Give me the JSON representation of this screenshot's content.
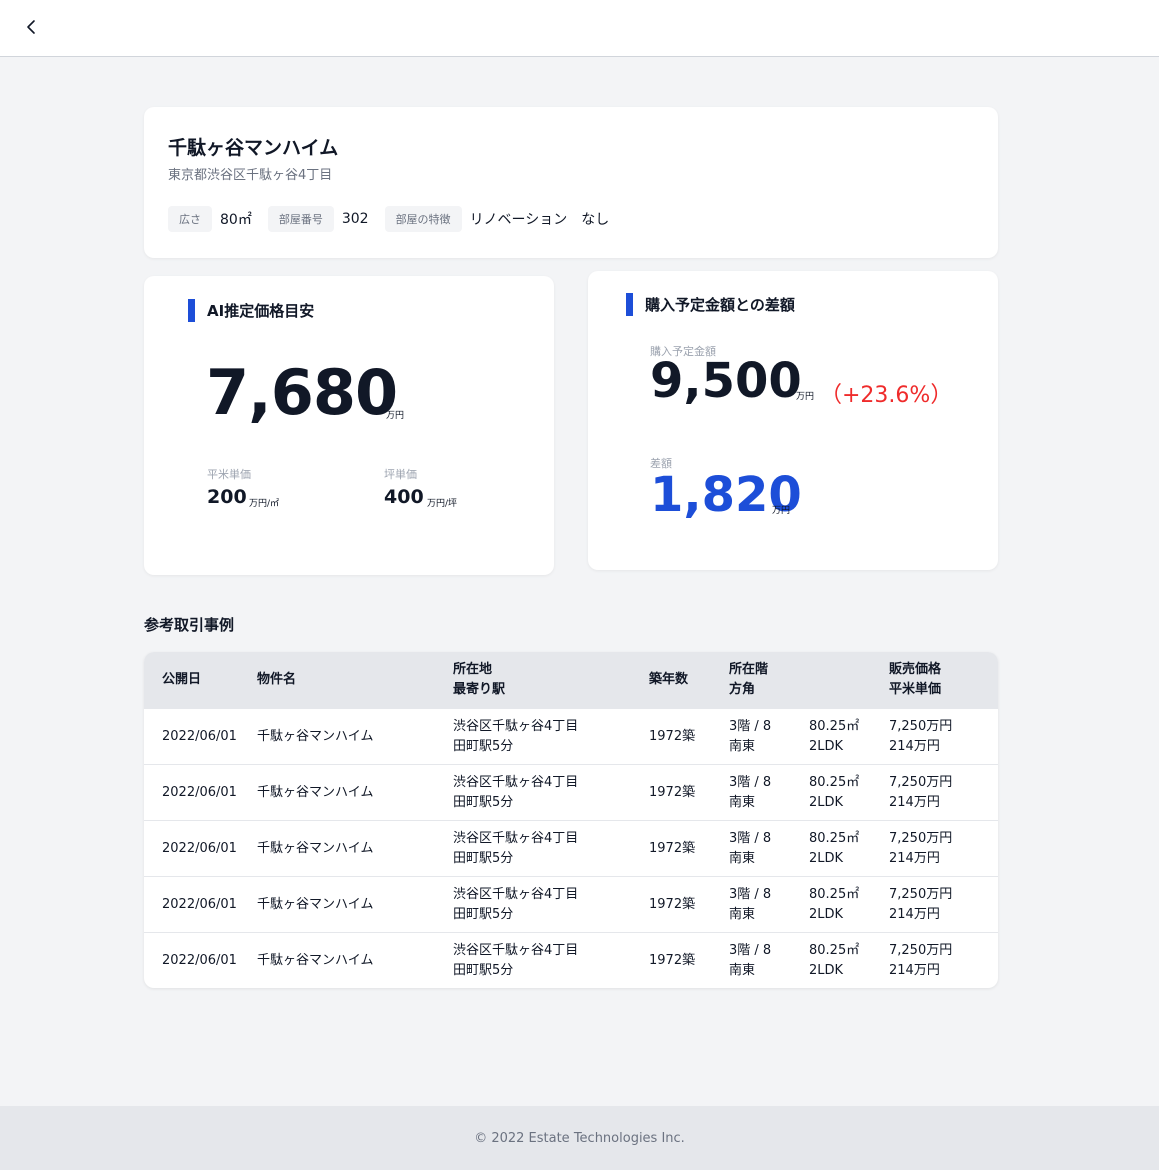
{
  "header": {
    "back_icon": "chevron-left-icon"
  },
  "property": {
    "name": "千駄ヶ谷マンハイム",
    "address": "東京都渋谷区千駄ヶ谷4丁目",
    "area_label": "広さ",
    "area_value": "80㎡",
    "room_label": "部屋番号",
    "room_value": "302",
    "feature_label": "部屋の特徴",
    "feature_value": "リノベーション",
    "feature_extra": "なし"
  },
  "ai_estimate": {
    "title": "AI推定価格目安",
    "price": "7,680",
    "price_unit": "万円",
    "sqm_label": "平米単価",
    "sqm_value": "200",
    "sqm_unit": "万円/㎡",
    "tsubo_label": "坪単価",
    "tsubo_value": "400",
    "tsubo_unit": "万円/坪"
  },
  "difference": {
    "title": "購入予定金額との差額",
    "planned_label": "購入予定金額",
    "planned_value": "9,500",
    "planned_unit": "万円",
    "planned_pct": "（+23.6%）",
    "gap_label": "差額",
    "gap_value": "1,820",
    "gap_unit": "万円"
  },
  "reference": {
    "title": "参考取引事例",
    "columns": {
      "date": "公開日",
      "name": "物件名",
      "location_1": "所在地",
      "location_2": "最寄り駅",
      "year": "築年数",
      "floor_1": "所在階",
      "floor_2": "方角",
      "price_1": "販売価格",
      "price_2": "平米単価"
    },
    "rows": [
      {
        "date": "2022/06/01",
        "name": "千駄ヶ谷マンハイム",
        "address": "渋谷区千駄ヶ谷4丁目",
        "station": "田町駅5分",
        "year": "1972築",
        "floor": "3階 / 8",
        "direction": "南東",
        "area": "80.25㎡",
        "layout": "2LDK",
        "price": "7,250万円",
        "unit_price": "214万円"
      },
      {
        "date": "2022/06/01",
        "name": "千駄ヶ谷マンハイム",
        "address": "渋谷区千駄ヶ谷4丁目",
        "station": "田町駅5分",
        "year": "1972築",
        "floor": "3階 / 8",
        "direction": "南東",
        "area": "80.25㎡",
        "layout": "2LDK",
        "price": "7,250万円",
        "unit_price": "214万円"
      },
      {
        "date": "2022/06/01",
        "name": "千駄ヶ谷マンハイム",
        "address": "渋谷区千駄ヶ谷4丁目",
        "station": "田町駅5分",
        "year": "1972築",
        "floor": "3階 / 8",
        "direction": "南東",
        "area": "80.25㎡",
        "layout": "2LDK",
        "price": "7,250万円",
        "unit_price": "214万円"
      },
      {
        "date": "2022/06/01",
        "name": "千駄ヶ谷マンハイム",
        "address": "渋谷区千駄ヶ谷4丁目",
        "station": "田町駅5分",
        "year": "1972築",
        "floor": "3階 / 8",
        "direction": "南東",
        "area": "80.25㎡",
        "layout": "2LDK",
        "price": "7,250万円",
        "unit_price": "214万円"
      },
      {
        "date": "2022/06/01",
        "name": "千駄ヶ谷マンハイム",
        "address": "渋谷区千駄ヶ谷4丁目",
        "station": "田町駅5分",
        "year": "1972築",
        "floor": "3階 / 8",
        "direction": "南東",
        "area": "80.25㎡",
        "layout": "2LDK",
        "price": "7,250万円",
        "unit_price": "214万円"
      }
    ]
  },
  "footer": {
    "copyright": "© 2022 Estate Technologies Inc."
  },
  "colors": {
    "accent": "#1d4ed8",
    "alert": "#ef2b2b"
  }
}
